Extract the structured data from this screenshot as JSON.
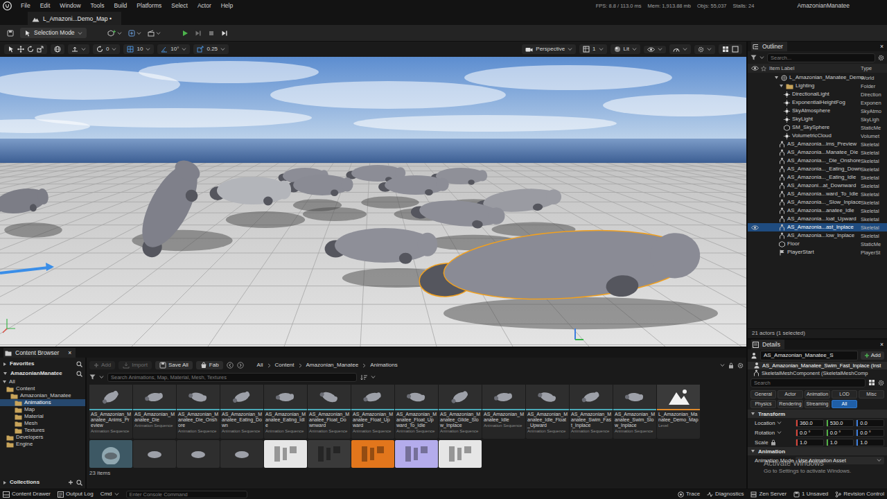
{
  "menu_bar": {
    "items": [
      "File",
      "Edit",
      "Window",
      "Tools",
      "Build",
      "Platforms",
      "Select",
      "Actor",
      "Help"
    ],
    "stats": [
      "FPS: 8.8 / 113.0 ms",
      "Mem: 1,913.88 mb",
      "Objs: 55,037",
      "Stalls: 24"
    ],
    "project": "AmazonianManatee"
  },
  "document_tabs": [
    {
      "label": "L_Amazoni...Demo_Map •",
      "selected": true
    }
  ],
  "main_toolbar": {
    "mode": "Selection Mode"
  },
  "viewport": {
    "snaps": [
      "0",
      "10",
      "10°",
      "0.25"
    ],
    "view": "Perspective",
    "fov": "1",
    "lighting": "Lit"
  },
  "outliner": {
    "title": "Outliner",
    "close": "×",
    "search_placeholder": "Search...",
    "columns": [
      "Item Label",
      "Type"
    ],
    "rows": [
      {
        "label": "L_Amazonian_Manatee_Demo",
        "type": "World",
        "kind": "world",
        "depth": 1,
        "expanded": true,
        "eye": false,
        "selected": false
      },
      {
        "label": "Lighting",
        "type": "Folder",
        "kind": "folder",
        "depth": 2,
        "expanded": true,
        "eye": false,
        "selected": false
      },
      {
        "label": "DirectionalLight",
        "type": "Direction",
        "kind": "light",
        "depth": 3,
        "eye": false,
        "selected": false
      },
      {
        "label": "ExponentialHeightFog",
        "type": "Exponen",
        "kind": "light",
        "depth": 3,
        "eye": false,
        "selected": false
      },
      {
        "label": "SkyAtmosphere",
        "type": "SkyAtmo",
        "kind": "light",
        "depth": 3,
        "eye": false,
        "selected": false
      },
      {
        "label": "SkyLight",
        "type": "SkyLigh",
        "kind": "light",
        "depth": 3,
        "eye": false,
        "selected": false
      },
      {
        "label": "SM_SkySphere",
        "type": "StaticMe",
        "kind": "mesh",
        "depth": 3,
        "eye": false,
        "selected": false
      },
      {
        "label": "VolumetricCloud",
        "type": "Volumet",
        "kind": "light",
        "depth": 3,
        "eye": false,
        "selected": false
      },
      {
        "label": "AS_Amazonia...ims_Preview",
        "type": "Skeletal",
        "kind": "skeletal",
        "depth": 2,
        "eye": false,
        "selected": false
      },
      {
        "label": "AS_Amazonia...Manatee_Die",
        "type": "Skeletal",
        "kind": "skeletal",
        "depth": 2,
        "eye": false,
        "selected": false
      },
      {
        "label": "AS_Amazonia..._Die_Onshore",
        "type": "Skeletal",
        "kind": "skeletal",
        "depth": 2,
        "eye": false,
        "selected": false
      },
      {
        "label": "AS_Amazonia..._Eating_Down",
        "type": "Skeletal",
        "kind": "skeletal",
        "depth": 2,
        "eye": false,
        "selected": false
      },
      {
        "label": "AS_Amazonia..._Eating_Idle",
        "type": "Skeletal",
        "kind": "skeletal",
        "depth": 2,
        "eye": false,
        "selected": false
      },
      {
        "label": "AS_Amazoni...at_Downward",
        "type": "Skeletal",
        "kind": "skeletal",
        "depth": 2,
        "eye": false,
        "selected": false
      },
      {
        "label": "AS_Amazonia...ward_To_Idle",
        "type": "Skeletal",
        "kind": "skeletal",
        "depth": 2,
        "eye": false,
        "selected": false
      },
      {
        "label": "AS_Amazonia..._Slow_Inplace",
        "type": "Skeletal",
        "kind": "skeletal",
        "depth": 2,
        "eye": false,
        "selected": false
      },
      {
        "label": "AS_Amazonia...anatee_Idle",
        "type": "Skeletal",
        "kind": "skeletal",
        "depth": 2,
        "eye": false,
        "selected": false
      },
      {
        "label": "AS_Amazonia...loat_Upward",
        "type": "Skeletal",
        "kind": "skeletal",
        "depth": 2,
        "eye": false,
        "selected": false
      },
      {
        "label": "AS_Amazonia...ast_Inplace",
        "type": "Skeletal",
        "kind": "skeletal",
        "depth": 2,
        "eye": true,
        "selected": true
      },
      {
        "label": "AS_Amazonia...low_Inplace",
        "type": "Skeletal",
        "kind": "skeletal",
        "depth": 2,
        "eye": false,
        "selected": false
      },
      {
        "label": "Floor",
        "type": "StaticMe",
        "kind": "mesh",
        "depth": 2,
        "eye": false,
        "selected": false
      },
      {
        "label": "PlayerStart",
        "type": "PlayerSt",
        "kind": "start",
        "depth": 2,
        "eye": false,
        "selected": false
      }
    ],
    "footer": "21 actors (1 selected)"
  },
  "details": {
    "title": "Details",
    "close": "×",
    "actor_name": "AS_Amazonian_Manatee_S",
    "add_button": "Add",
    "components": [
      {
        "label": "AS_Amazonian_Manatee_Swim_Fast_Inplace (Inst",
        "selected": true
      },
      {
        "label": "SkeletalMeshComponent (SkeletalMeshComp",
        "selected": false
      }
    ],
    "search_placeholder": "Search",
    "filters": [
      {
        "label": "General",
        "selected": false
      },
      {
        "label": "Actor",
        "selected": false
      },
      {
        "label": "Animation",
        "selected": false
      },
      {
        "label": "LOD",
        "selected": false
      },
      {
        "label": "Misc",
        "selected": false
      },
      {
        "label": "Physics",
        "selected": false
      },
      {
        "label": "Rendering",
        "selected": false
      },
      {
        "label": "Streaming",
        "selected": false
      },
      {
        "label": "All",
        "selected": true
      }
    ],
    "axis_colors": [
      "#d9453a",
      "#52b043",
      "#3b7ddd"
    ],
    "sections": [
      {
        "title": "Transform",
        "expanded": true,
        "rows": [
          {
            "kind": "vector",
            "label": "Location",
            "values": [
              "360.0",
              "530.0",
              "0.0"
            ]
          },
          {
            "kind": "vector",
            "label": "Rotation",
            "values": [
              "0.0 °",
              "0.0 °",
              "0.0 °"
            ]
          },
          {
            "kind": "vector",
            "label": "Scale",
            "values": [
              "1.0",
              "1.0",
              "1.0"
            ]
          }
        ]
      },
      {
        "title": "Animation",
        "expanded": true,
        "rows": [
          {
            "kind": "dropdown",
            "label": "Animation Mode",
            "value": "Use Animation Asset"
          }
        ]
      }
    ]
  },
  "content_browser": {
    "title": "Content Browser",
    "close": "×",
    "favorites": "Favorites",
    "project": "AmazonianManatee",
    "tree": [
      {
        "label": "All",
        "depth": 0,
        "kind": "root",
        "selected": false
      },
      {
        "label": "Content",
        "depth": 1,
        "kind": "folder",
        "selected": false
      },
      {
        "label": "Amazonian_Manatee",
        "depth": 2,
        "kind": "folder",
        "selected": false
      },
      {
        "label": "Animations",
        "depth": 3,
        "kind": "folder",
        "selected": true
      },
      {
        "label": "Map",
        "depth": 3,
        "kind": "folder",
        "selected": false
      },
      {
        "label": "Material",
        "depth": 3,
        "kind": "folder",
        "selected": false
      },
      {
        "label": "Mesh",
        "depth": 3,
        "kind": "folder",
        "selected": false
      },
      {
        "label": "Textures",
        "depth": 3,
        "kind": "folder",
        "selected": false
      },
      {
        "label": "Developers",
        "depth": 1,
        "kind": "folder",
        "selected": false
      },
      {
        "label": "Engine",
        "depth": 1,
        "kind": "folder",
        "selected": false
      }
    ],
    "collections": "Collections",
    "buttons": [
      {
        "label": "Add",
        "disabled": true
      },
      {
        "label": "Import",
        "disabled": true
      },
      {
        "label": "Save All",
        "disabled": false
      },
      {
        "label": "Fab",
        "disabled": false
      }
    ],
    "path": [
      "All",
      "Content",
      "Amazonian_Manatee",
      "Animations"
    ],
    "search_placeholder": "Search Animations, Map, Material, Mesh, Textures",
    "assets": [
      {
        "name": "AS_Amazonian_Manatee_Anims_Preview",
        "type": "Animation Sequence",
        "kind": "animation"
      },
      {
        "name": "AS_Amazonian_Manatee_Die",
        "type": "Animation Sequence",
        "kind": "animation"
      },
      {
        "name": "AS_Amazonian_Manatee_Die_Onshore",
        "type": "Animation Sequence",
        "kind": "animation"
      },
      {
        "name": "AS_Amazonian_Manatee_Eating_Down",
        "type": "Animation Sequence",
        "kind": "animation"
      },
      {
        "name": "AS_Amazonian_Manatee_Eating_Idle",
        "type": "Animation Sequence",
        "kind": "animation"
      },
      {
        "name": "AS_Amazonian_Manatee_Float_Downward",
        "type": "Animation Sequence",
        "kind": "animation"
      },
      {
        "name": "AS_Amazonian_Manatee_Float_Upward",
        "type": "Animation Sequence",
        "kind": "animation"
      },
      {
        "name": "AS_Amazonian_Manatee_Float_Upward_To_Idle",
        "type": "Animation Sequence",
        "kind": "animation"
      },
      {
        "name": "AS_Amazonian_Manatee_Glide_Slow_Inplace",
        "type": "Animation Sequence",
        "kind": "animation"
      },
      {
        "name": "AS_Amazonian_Manatee_Idle",
        "type": "Animation Sequence",
        "kind": "animation"
      },
      {
        "name": "AS_Amazonian_Manatee_Idle_Float_Upward",
        "type": "Animation Sequence",
        "kind": "animation"
      },
      {
        "name": "AS_Amazonian_Manatee_Swim_Fast_Inplace",
        "type": "Animation Sequence",
        "kind": "animation"
      },
      {
        "name": "AS_Amazonian_Manatee_Swim_Slow_Inplace",
        "type": "Animation Sequence",
        "kind": "animation"
      },
      {
        "name": "L_Amazonian_Manatee_Demo_Map",
        "type": "Level",
        "kind": "level"
      }
    ],
    "more_assets": [
      {
        "kind": "mesh",
        "color": "#3d5864"
      },
      {
        "kind": "animation",
        "color": "#2e2e2e"
      },
      {
        "kind": "animation",
        "color": "#2e2e2e"
      },
      {
        "kind": "animation",
        "color": "#2e2e2e"
      },
      {
        "kind": "texture",
        "color": "#e6e6e6"
      },
      {
        "kind": "texture",
        "color": "#3a3a3a"
      },
      {
        "kind": "texture",
        "color": "#e2761c"
      },
      {
        "kind": "texture",
        "color": "#b4acec"
      },
      {
        "kind": "texture",
        "color": "#e6e6e6"
      }
    ],
    "count": "23 items"
  },
  "status_bar": {
    "left": [
      "Content Drawer",
      "Output Log",
      "Cmd"
    ],
    "console_placeholder": "Enter Console Command",
    "right": [
      "Trace",
      "Diagnostics",
      "Zen Server",
      "1 Unsaved",
      "Revision Control"
    ]
  },
  "watermark": {
    "title": "Activate Windows",
    "subtitle": "Go to Settings to activate Windows."
  }
}
